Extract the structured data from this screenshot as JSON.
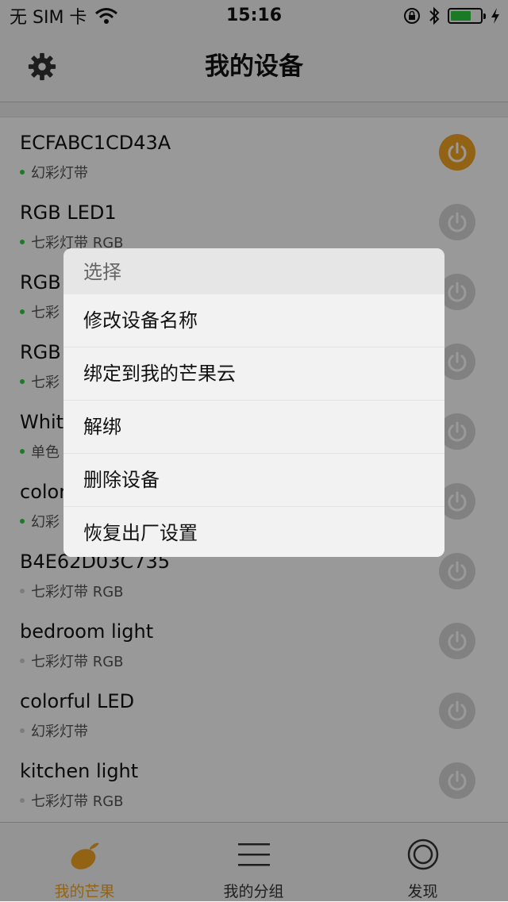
{
  "status_bar": {
    "carrier": "无 SIM 卡",
    "time": "15:16",
    "battery_level": 0.7
  },
  "nav": {
    "title": "我的设备"
  },
  "colors": {
    "accent": "#f5a623",
    "online": "#2ecc40",
    "offline": "#cfcfcf"
  },
  "devices": [
    {
      "name": "ECFABC1CD43A",
      "type": "幻彩灯带",
      "online": true,
      "power_on": true
    },
    {
      "name": "RGB LED1",
      "type": "七彩灯带 RGB",
      "online": true,
      "power_on": false
    },
    {
      "name": "RGB",
      "type": "七彩",
      "online": true,
      "power_on": false
    },
    {
      "name": "RGB",
      "type": "七彩",
      "online": true,
      "power_on": false
    },
    {
      "name": "Whit",
      "type": "单色",
      "online": true,
      "power_on": false
    },
    {
      "name": "color",
      "type": "幻彩",
      "online": true,
      "power_on": false
    },
    {
      "name": "B4E62D03C735",
      "type": "七彩灯带 RGB",
      "online": false,
      "power_on": false
    },
    {
      "name": "bedroom light",
      "type": "七彩灯带 RGB",
      "online": false,
      "power_on": false
    },
    {
      "name": "colorful LED",
      "type": "幻彩灯带",
      "online": false,
      "power_on": false
    },
    {
      "name": "kitchen light",
      "type": "七彩灯带 RGB",
      "online": false,
      "power_on": false
    }
  ],
  "tabs": [
    {
      "label": "我的芒果",
      "icon": "mango-icon",
      "active": true
    },
    {
      "label": "我的分组",
      "icon": "menu-lines-icon",
      "active": false
    },
    {
      "label": "发现",
      "icon": "target-circle-icon",
      "active": false
    }
  ],
  "action_sheet": {
    "title": "选择",
    "items": [
      "修改设备名称",
      "绑定到我的芒果云",
      "解绑",
      "删除设备",
      "恢复出厂设置"
    ]
  }
}
